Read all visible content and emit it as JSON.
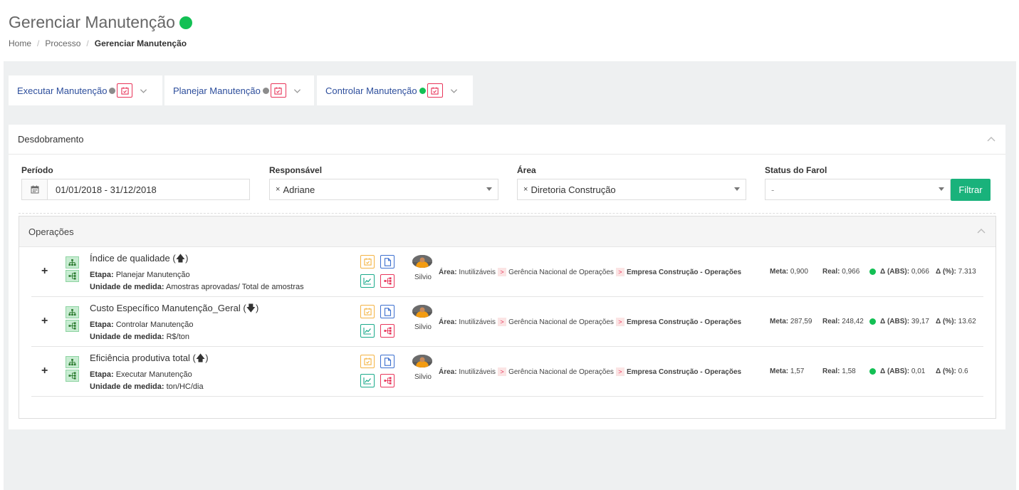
{
  "header": {
    "title": "Gerenciar Manutenção",
    "status_color": "#13c054",
    "breadcrumb": [
      "Home",
      "Processo",
      "Gerenciar Manutenção"
    ]
  },
  "tabs": [
    {
      "label": "Executar Manutenção",
      "dot_color": "#8c8c8c"
    },
    {
      "label": "Planejar Manutenção",
      "dot_color": "#8c8c8c"
    },
    {
      "label": "Controlar Manutenção",
      "dot_color": "#13c054"
    }
  ],
  "desdobramento": {
    "title": "Desdobramento",
    "periodo_label": "Período",
    "periodo_value": "01/01/2018 - 31/12/2018",
    "responsavel_label": "Responsável",
    "responsavel_value": "Adriane",
    "area_label": "Área",
    "area_value": "Diretoria Construção",
    "status_label": "Status do Farol",
    "status_value": "-",
    "filter_button": "Filtrar",
    "filter_button_color": "#19b27b"
  },
  "operacoes": {
    "title": "Operações",
    "rows": [
      {
        "title": "Índice de qualidade (🡅)",
        "etapa_label": "Etapa:",
        "etapa": "Planejar Manutenção",
        "unidade_label": "Unidade de medida:",
        "unidade": "Amostras aprovadas/ Total de amostras",
        "responsavel": "Silvio",
        "area_label": "Área:",
        "area_path": [
          "Inutilizáveis",
          "Gerência Nacional de Operações",
          "Empresa Construção - Operações"
        ],
        "meta_label": "Meta:",
        "meta": "0,900",
        "real_label": "Real:",
        "real": "0,966",
        "abs_label": "Δ (ABS):",
        "abs": "0,066",
        "pct_label": "Δ (%):",
        "pct": "7.313",
        "status_color": "#13c054"
      },
      {
        "title": "Custo Específico Manutenção_Geral (🡇)",
        "etapa_label": "Etapa:",
        "etapa": "Controlar Manutenção",
        "unidade_label": "Unidade de medida:",
        "unidade": "R$/ton",
        "responsavel": "Silvio",
        "area_label": "Área:",
        "area_path": [
          "Inutilizáveis",
          "Gerência Nacional de Operações",
          "Empresa Construção - Operações"
        ],
        "meta_label": "Meta:",
        "meta": "287,59",
        "real_label": "Real:",
        "real": "248,42",
        "abs_label": "Δ (ABS):",
        "abs": "39,17",
        "pct_label": "Δ (%):",
        "pct": "13.62",
        "status_color": "#13c054"
      },
      {
        "title": "Eficiência produtiva total (🡅)",
        "etapa_label": "Etapa:",
        "etapa": "Executar Manutenção",
        "unidade_label": "Unidade de medida:",
        "unidade": "ton/HC/dia",
        "responsavel": "Silvio",
        "area_label": "Área:",
        "area_path": [
          "Inutilizáveis",
          "Gerência Nacional de Operações",
          "Empresa Construção - Operações"
        ],
        "meta_label": "Meta:",
        "meta": "1,57",
        "real_label": "Real:",
        "real": "1,58",
        "abs_label": "Δ (ABS):",
        "abs": "0,01",
        "pct_label": "Δ (%):",
        "pct": "0.6",
        "status_color": "#13c054"
      }
    ]
  }
}
